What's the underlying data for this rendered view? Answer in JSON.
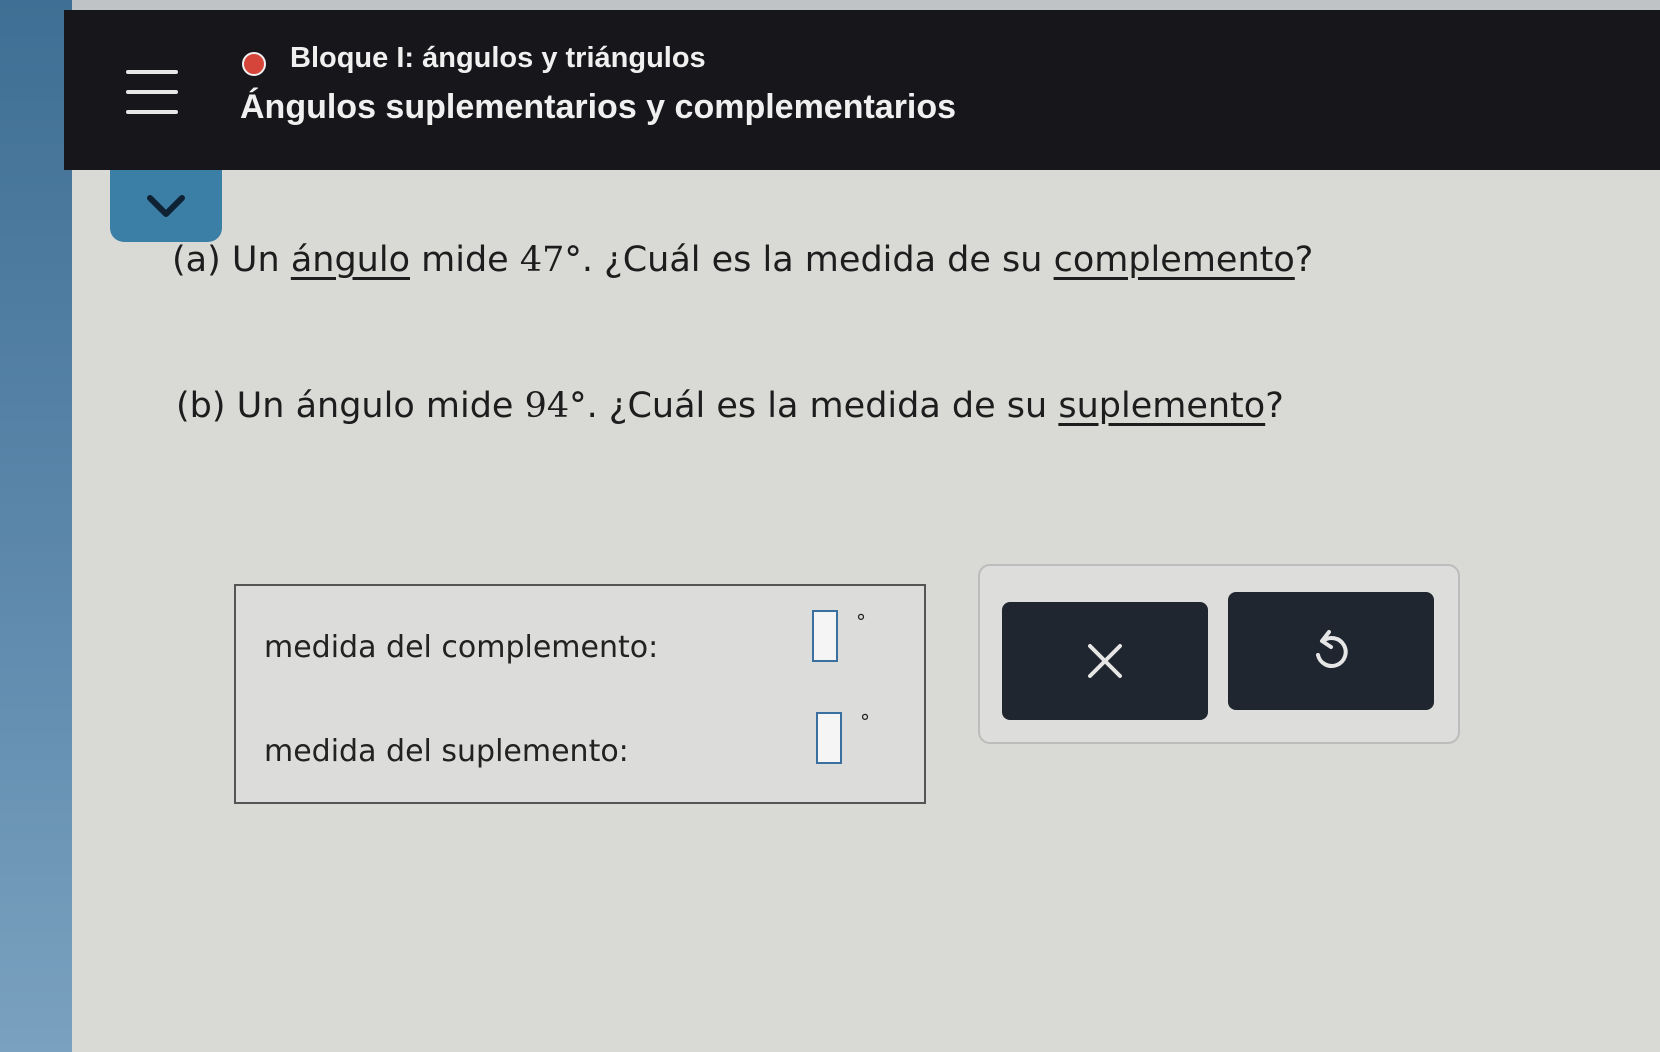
{
  "header": {
    "block_title": "Bloque I: ángulos y triángulos",
    "lesson_title": "Ángulos suplementarios y complementarios",
    "status_color": "#d6453a"
  },
  "questions": {
    "a": {
      "label": "(a)",
      "before": " Un ",
      "term1": "ángulo",
      "mid": " mide ",
      "value": "47°",
      "after": ". ¿Cuál es la medida de su ",
      "term2": "complemento",
      "end": "?"
    },
    "b": {
      "label": "(b)",
      "before": " Un ángulo mide ",
      "value": "94°",
      "after": ". ¿Cuál es la medida de su ",
      "term2": "suplemento",
      "end": "?"
    }
  },
  "answers": {
    "complement_label": "medida del complemento:",
    "complement_value": "",
    "supplement_label": "medida del suplemento:",
    "supplement_value": "",
    "degree_symbol": "°"
  },
  "tools": {
    "clear_icon": "close-icon",
    "undo_icon": "undo-icon"
  },
  "colors": {
    "header_bg": "#17171b",
    "accent_tab": "#3b7ea6",
    "button_bg": "#1f2630"
  }
}
